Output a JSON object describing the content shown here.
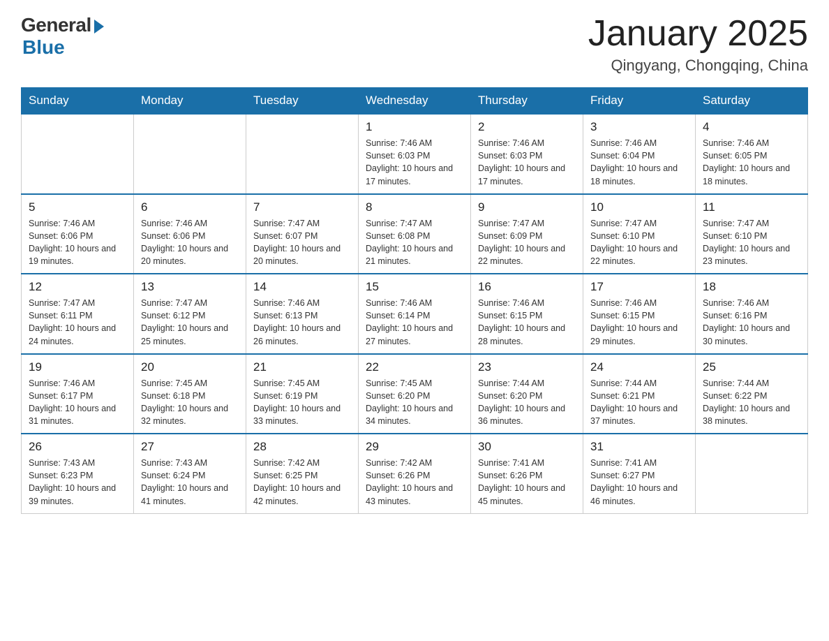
{
  "logo": {
    "general": "General",
    "blue": "Blue"
  },
  "title": "January 2025",
  "location": "Qingyang, Chongqing, China",
  "days_of_week": [
    "Sunday",
    "Monday",
    "Tuesday",
    "Wednesday",
    "Thursday",
    "Friday",
    "Saturday"
  ],
  "weeks": [
    [
      {
        "day": "",
        "sunrise": "",
        "sunset": "",
        "daylight": ""
      },
      {
        "day": "",
        "sunrise": "",
        "sunset": "",
        "daylight": ""
      },
      {
        "day": "",
        "sunrise": "",
        "sunset": "",
        "daylight": ""
      },
      {
        "day": "1",
        "sunrise": "Sunrise: 7:46 AM",
        "sunset": "Sunset: 6:03 PM",
        "daylight": "Daylight: 10 hours and 17 minutes."
      },
      {
        "day": "2",
        "sunrise": "Sunrise: 7:46 AM",
        "sunset": "Sunset: 6:03 PM",
        "daylight": "Daylight: 10 hours and 17 minutes."
      },
      {
        "day": "3",
        "sunrise": "Sunrise: 7:46 AM",
        "sunset": "Sunset: 6:04 PM",
        "daylight": "Daylight: 10 hours and 18 minutes."
      },
      {
        "day": "4",
        "sunrise": "Sunrise: 7:46 AM",
        "sunset": "Sunset: 6:05 PM",
        "daylight": "Daylight: 10 hours and 18 minutes."
      }
    ],
    [
      {
        "day": "5",
        "sunrise": "Sunrise: 7:46 AM",
        "sunset": "Sunset: 6:06 PM",
        "daylight": "Daylight: 10 hours and 19 minutes."
      },
      {
        "day": "6",
        "sunrise": "Sunrise: 7:46 AM",
        "sunset": "Sunset: 6:06 PM",
        "daylight": "Daylight: 10 hours and 20 minutes."
      },
      {
        "day": "7",
        "sunrise": "Sunrise: 7:47 AM",
        "sunset": "Sunset: 6:07 PM",
        "daylight": "Daylight: 10 hours and 20 minutes."
      },
      {
        "day": "8",
        "sunrise": "Sunrise: 7:47 AM",
        "sunset": "Sunset: 6:08 PM",
        "daylight": "Daylight: 10 hours and 21 minutes."
      },
      {
        "day": "9",
        "sunrise": "Sunrise: 7:47 AM",
        "sunset": "Sunset: 6:09 PM",
        "daylight": "Daylight: 10 hours and 22 minutes."
      },
      {
        "day": "10",
        "sunrise": "Sunrise: 7:47 AM",
        "sunset": "Sunset: 6:10 PM",
        "daylight": "Daylight: 10 hours and 22 minutes."
      },
      {
        "day": "11",
        "sunrise": "Sunrise: 7:47 AM",
        "sunset": "Sunset: 6:10 PM",
        "daylight": "Daylight: 10 hours and 23 minutes."
      }
    ],
    [
      {
        "day": "12",
        "sunrise": "Sunrise: 7:47 AM",
        "sunset": "Sunset: 6:11 PM",
        "daylight": "Daylight: 10 hours and 24 minutes."
      },
      {
        "day": "13",
        "sunrise": "Sunrise: 7:47 AM",
        "sunset": "Sunset: 6:12 PM",
        "daylight": "Daylight: 10 hours and 25 minutes."
      },
      {
        "day": "14",
        "sunrise": "Sunrise: 7:46 AM",
        "sunset": "Sunset: 6:13 PM",
        "daylight": "Daylight: 10 hours and 26 minutes."
      },
      {
        "day": "15",
        "sunrise": "Sunrise: 7:46 AM",
        "sunset": "Sunset: 6:14 PM",
        "daylight": "Daylight: 10 hours and 27 minutes."
      },
      {
        "day": "16",
        "sunrise": "Sunrise: 7:46 AM",
        "sunset": "Sunset: 6:15 PM",
        "daylight": "Daylight: 10 hours and 28 minutes."
      },
      {
        "day": "17",
        "sunrise": "Sunrise: 7:46 AM",
        "sunset": "Sunset: 6:15 PM",
        "daylight": "Daylight: 10 hours and 29 minutes."
      },
      {
        "day": "18",
        "sunrise": "Sunrise: 7:46 AM",
        "sunset": "Sunset: 6:16 PM",
        "daylight": "Daylight: 10 hours and 30 minutes."
      }
    ],
    [
      {
        "day": "19",
        "sunrise": "Sunrise: 7:46 AM",
        "sunset": "Sunset: 6:17 PM",
        "daylight": "Daylight: 10 hours and 31 minutes."
      },
      {
        "day": "20",
        "sunrise": "Sunrise: 7:45 AM",
        "sunset": "Sunset: 6:18 PM",
        "daylight": "Daylight: 10 hours and 32 minutes."
      },
      {
        "day": "21",
        "sunrise": "Sunrise: 7:45 AM",
        "sunset": "Sunset: 6:19 PM",
        "daylight": "Daylight: 10 hours and 33 minutes."
      },
      {
        "day": "22",
        "sunrise": "Sunrise: 7:45 AM",
        "sunset": "Sunset: 6:20 PM",
        "daylight": "Daylight: 10 hours and 34 minutes."
      },
      {
        "day": "23",
        "sunrise": "Sunrise: 7:44 AM",
        "sunset": "Sunset: 6:20 PM",
        "daylight": "Daylight: 10 hours and 36 minutes."
      },
      {
        "day": "24",
        "sunrise": "Sunrise: 7:44 AM",
        "sunset": "Sunset: 6:21 PM",
        "daylight": "Daylight: 10 hours and 37 minutes."
      },
      {
        "day": "25",
        "sunrise": "Sunrise: 7:44 AM",
        "sunset": "Sunset: 6:22 PM",
        "daylight": "Daylight: 10 hours and 38 minutes."
      }
    ],
    [
      {
        "day": "26",
        "sunrise": "Sunrise: 7:43 AM",
        "sunset": "Sunset: 6:23 PM",
        "daylight": "Daylight: 10 hours and 39 minutes."
      },
      {
        "day": "27",
        "sunrise": "Sunrise: 7:43 AM",
        "sunset": "Sunset: 6:24 PM",
        "daylight": "Daylight: 10 hours and 41 minutes."
      },
      {
        "day": "28",
        "sunrise": "Sunrise: 7:42 AM",
        "sunset": "Sunset: 6:25 PM",
        "daylight": "Daylight: 10 hours and 42 minutes."
      },
      {
        "day": "29",
        "sunrise": "Sunrise: 7:42 AM",
        "sunset": "Sunset: 6:26 PM",
        "daylight": "Daylight: 10 hours and 43 minutes."
      },
      {
        "day": "30",
        "sunrise": "Sunrise: 7:41 AM",
        "sunset": "Sunset: 6:26 PM",
        "daylight": "Daylight: 10 hours and 45 minutes."
      },
      {
        "day": "31",
        "sunrise": "Sunrise: 7:41 AM",
        "sunset": "Sunset: 6:27 PM",
        "daylight": "Daylight: 10 hours and 46 minutes."
      },
      {
        "day": "",
        "sunrise": "",
        "sunset": "",
        "daylight": ""
      }
    ]
  ]
}
